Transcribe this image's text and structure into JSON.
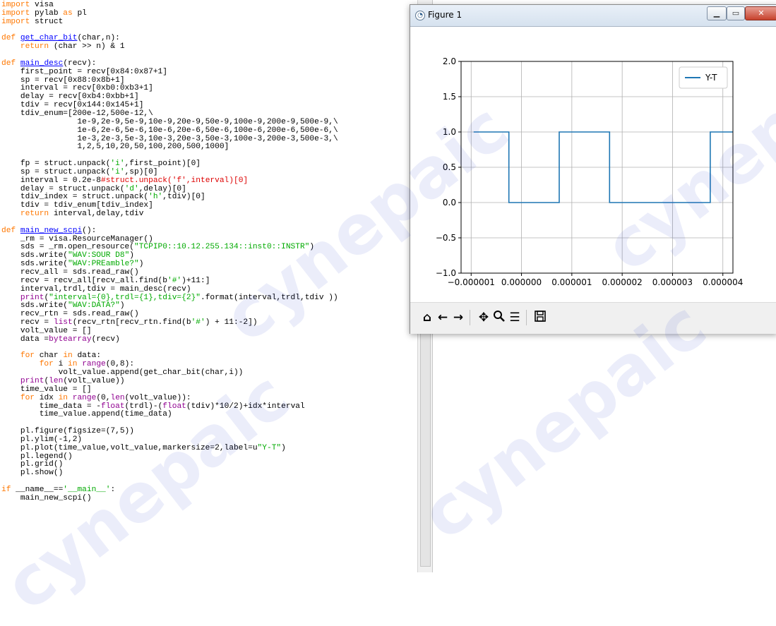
{
  "editor": {
    "lines": [
      [
        [
          "import",
          "kw"
        ],
        [
          " visa",
          ""
        ]
      ],
      [
        [
          "import",
          "kw"
        ],
        [
          " pylab ",
          ""
        ],
        [
          "as",
          "kw"
        ],
        [
          " pl",
          ""
        ]
      ],
      [
        [
          "import",
          "kw"
        ],
        [
          " struct",
          ""
        ]
      ],
      [],
      [
        [
          "def",
          "kw"
        ],
        [
          " ",
          ""
        ],
        [
          "get_char_bit",
          "fn"
        ],
        [
          "(char,n):",
          ""
        ]
      ],
      [
        [
          "    ",
          ""
        ],
        [
          "return",
          "kw"
        ],
        [
          " (char >> n) & 1",
          ""
        ]
      ],
      [],
      [
        [
          "def",
          "kw"
        ],
        [
          " ",
          ""
        ],
        [
          "main_desc",
          "fn"
        ],
        [
          "(recv):",
          ""
        ]
      ],
      [
        [
          "    first_point = recv[0x84:0x87+1]",
          ""
        ]
      ],
      [
        [
          "    sp = recv[0x88:0x8b+1]",
          ""
        ]
      ],
      [
        [
          "    interval = recv[0xb0:0xb3+1]",
          ""
        ]
      ],
      [
        [
          "    delay = recv[0xb4:0xbb+1]",
          ""
        ]
      ],
      [
        [
          "    tdiv = recv[0x144:0x145+1]",
          ""
        ]
      ],
      [
        [
          "    tdiv_enum=[200e-12,500e-12,\\",
          ""
        ]
      ],
      [
        [
          "                1e-9,2e-9,5e-9,10e-9,20e-9,50e-9,100e-9,200e-9,500e-9,\\",
          ""
        ]
      ],
      [
        [
          "                1e-6,2e-6,5e-6,10e-6,20e-6,50e-6,100e-6,200e-6,500e-6,\\",
          ""
        ]
      ],
      [
        [
          "                1e-3,2e-3,5e-3,10e-3,20e-3,50e-3,100e-3,200e-3,500e-3,\\",
          ""
        ]
      ],
      [
        [
          "                1,2,5,10,20,50,100,200,500,1000]",
          ""
        ]
      ],
      [],
      [
        [
          "    fp = struct.unpack(",
          ""
        ],
        [
          "'i'",
          "str"
        ],
        [
          ",first_point)[0]",
          ""
        ]
      ],
      [
        [
          "    sp = struct.unpack(",
          ""
        ],
        [
          "'i'",
          "str"
        ],
        [
          ",sp)[0]",
          ""
        ]
      ],
      [
        [
          "    interval = 0.2e-8",
          ""
        ],
        [
          "#struct.unpack('f',interval)[0]",
          "cm"
        ]
      ],
      [
        [
          "    delay = struct.unpack(",
          ""
        ],
        [
          "'d'",
          "str"
        ],
        [
          ",delay)[0]",
          ""
        ]
      ],
      [
        [
          "    tdiv_index = struct.unpack(",
          ""
        ],
        [
          "'h'",
          "str"
        ],
        [
          ",tdiv)[0]",
          ""
        ]
      ],
      [
        [
          "    tdiv = tdiv_enum[tdiv_index]",
          ""
        ]
      ],
      [
        [
          "    ",
          ""
        ],
        [
          "return",
          "kw"
        ],
        [
          " interval,delay,tdiv",
          ""
        ]
      ],
      [],
      [
        [
          "def",
          "kw"
        ],
        [
          " ",
          ""
        ],
        [
          "main_new_scpi",
          "fn"
        ],
        [
          "():",
          ""
        ]
      ],
      [
        [
          "    _rm = visa.ResourceManager()",
          ""
        ]
      ],
      [
        [
          "    sds = _rm.open_resource(",
          ""
        ],
        [
          "\"TCPIP0::10.12.255.134::inst0::INSTR\"",
          "str"
        ],
        [
          ")",
          ""
        ]
      ],
      [
        [
          "    sds.write(",
          ""
        ],
        [
          "\"WAV:SOUR D8\"",
          "str"
        ],
        [
          ")",
          ""
        ]
      ],
      [
        [
          "    sds.write(",
          ""
        ],
        [
          "\"WAV:PREamble?\"",
          "str"
        ],
        [
          ")",
          ""
        ]
      ],
      [
        [
          "    recv_all = sds.read_raw()",
          ""
        ]
      ],
      [
        [
          "    recv = recv_all[recv_all.find(b",
          ""
        ],
        [
          "'#'",
          "str"
        ],
        [
          ")+11:]",
          ""
        ]
      ],
      [
        [
          "    interval,trdl,tdiv = main_desc(recv)",
          ""
        ]
      ],
      [
        [
          "    ",
          ""
        ],
        [
          "print",
          "bi"
        ],
        [
          "(",
          ""
        ],
        [
          "\"interval={0},trdl={1},tdiv={2}\"",
          "str"
        ],
        [
          ".format(interval,trdl,tdiv ))",
          ""
        ]
      ],
      [
        [
          "    sds.write(",
          ""
        ],
        [
          "\"WAV:DATA?\"",
          "str"
        ],
        [
          ")",
          ""
        ]
      ],
      [
        [
          "    recv_rtn = sds.read_raw()",
          ""
        ]
      ],
      [
        [
          "    recv = ",
          ""
        ],
        [
          "list",
          "bi"
        ],
        [
          "(recv_rtn[recv_rtn.find(b",
          ""
        ],
        [
          "'#'",
          "str"
        ],
        [
          ") + 11:-2])",
          ""
        ]
      ],
      [
        [
          "    volt_value = []",
          ""
        ]
      ],
      [
        [
          "    data =",
          ""
        ],
        [
          "bytearray",
          "bi"
        ],
        [
          "(recv)",
          ""
        ]
      ],
      [],
      [
        [
          "    ",
          ""
        ],
        [
          "for",
          "kw"
        ],
        [
          " char ",
          ""
        ],
        [
          "in",
          "kw"
        ],
        [
          " data:",
          ""
        ]
      ],
      [
        [
          "        ",
          ""
        ],
        [
          "for",
          "kw"
        ],
        [
          " i ",
          ""
        ],
        [
          "in",
          "kw"
        ],
        [
          " ",
          ""
        ],
        [
          "range",
          "bi"
        ],
        [
          "(0,8):",
          ""
        ]
      ],
      [
        [
          "            volt_value.append(get_char_bit(char,i))",
          ""
        ]
      ],
      [
        [
          "    ",
          ""
        ],
        [
          "print",
          "bi"
        ],
        [
          "(",
          ""
        ],
        [
          "len",
          "bi"
        ],
        [
          "(volt_value))",
          ""
        ]
      ],
      [
        [
          "    time_value = []",
          ""
        ]
      ],
      [
        [
          "    ",
          ""
        ],
        [
          "for",
          "kw"
        ],
        [
          " idx ",
          ""
        ],
        [
          "in",
          "kw"
        ],
        [
          " ",
          ""
        ],
        [
          "range",
          "bi"
        ],
        [
          "(0,",
          ""
        ],
        [
          "len",
          "bi"
        ],
        [
          "(volt_value)):",
          ""
        ]
      ],
      [
        [
          "        time_data = -",
          ""
        ],
        [
          "float",
          "bi"
        ],
        [
          "(trdl)-(",
          ""
        ],
        [
          "float",
          "bi"
        ],
        [
          "(tdiv)*10/2)+idx*interval",
          ""
        ]
      ],
      [
        [
          "        time_value.append(time_data)",
          ""
        ]
      ],
      [],
      [
        [
          "    pl.figure(figsize=(7,5))",
          ""
        ]
      ],
      [
        [
          "    pl.ylim(-1,2)",
          ""
        ]
      ],
      [
        [
          "    pl.plot(time_value,volt_value,markersize=2,label=u",
          ""
        ],
        [
          "\"Y-T\"",
          "str"
        ],
        [
          ")",
          ""
        ]
      ],
      [
        [
          "    pl.legend()",
          ""
        ]
      ],
      [
        [
          "    pl.grid()",
          ""
        ]
      ],
      [
        [
          "    pl.show()",
          ""
        ]
      ],
      [],
      [
        [
          "if",
          "kw"
        ],
        [
          " __name__==",
          ""
        ],
        [
          "'__main__'",
          "str"
        ],
        [
          ":",
          ""
        ]
      ],
      [
        [
          "    main_new_scpi()",
          ""
        ]
      ]
    ]
  },
  "figure_window": {
    "title": "Figure 1",
    "icon": "figure-app-icon",
    "controls": [
      "minimize",
      "maximize",
      "close"
    ]
  },
  "toolbar": {
    "icons": [
      "home-icon",
      "back-arrow-icon",
      "forward-arrow-icon",
      "pan-icon",
      "zoom-icon",
      "subplots-config-icon",
      "save-icon"
    ],
    "glyphs": [
      "⌂",
      "←",
      "→",
      "✥",
      "🔍",
      "☰",
      "🖫"
    ]
  },
  "watermark": {
    "text": "cynepaic"
  },
  "chart_data": {
    "type": "line",
    "legend": [
      "Y-T"
    ],
    "legend_position": "upper right",
    "grid": true,
    "series_color": "#1f77b4",
    "xlim": [
      -1.2e-06,
      4.2e-06
    ],
    "ylim": [
      -1.0,
      2.0
    ],
    "xticks": [
      -1e-06,
      0.0,
      1e-06,
      2e-06,
      3e-06,
      4e-06
    ],
    "xticklabels": [
      "−0.000001",
      "0.000000",
      "0.000001",
      "0.000002",
      "0.000003",
      "0.000004"
    ],
    "yticks": [
      -1.0,
      -0.5,
      0.0,
      0.5,
      1.0,
      1.5,
      2.0
    ],
    "yticklabels": [
      "−1.0",
      "−0.5",
      "0.0",
      "0.5",
      "1.0",
      "1.5",
      "2.0"
    ],
    "series": [
      {
        "name": "Y-T",
        "x": [
          -9.5e-07,
          -2.5e-07,
          -2.5e-07,
          7.5e-07,
          7.5e-07,
          1.75e-06,
          1.75e-06,
          2.75e-06,
          2.75e-06,
          3.75e-06,
          3.75e-06,
          4.2e-06
        ],
        "y": [
          1,
          1,
          0,
          0,
          1,
          1,
          0,
          0,
          0,
          0,
          1,
          1
        ]
      }
    ]
  }
}
